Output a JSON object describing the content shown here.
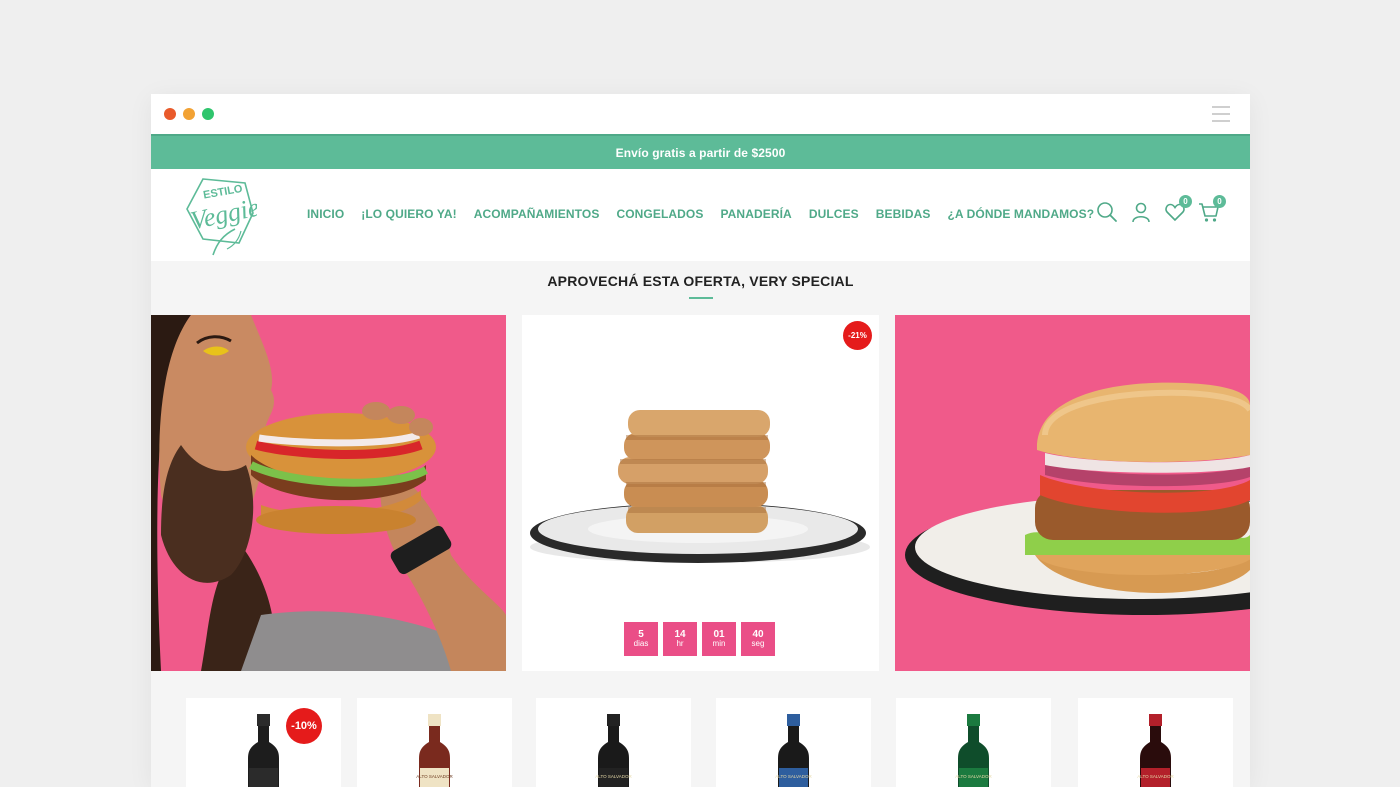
{
  "colors": {
    "brand_green": "#5dbb98",
    "nav_green": "#4fa988",
    "pink": "#f05a8a",
    "countdown_pink": "#ea4e87",
    "badge_red": "#e51b1b",
    "dot_red": "#e95a2b",
    "dot_orange": "#f2a234",
    "dot_green": "#2fc56d"
  },
  "window": {
    "menu_icon": "hamburger-icon"
  },
  "promo": {
    "text": "Envío gratis a partir de $2500"
  },
  "header": {
    "logo_top": "ESTILO",
    "logo_main": "Veggie",
    "nav": [
      "INICIO",
      "¡LO QUIERO YA!",
      "ACOMPAÑAMIENTOS",
      "CONGELADOS",
      "PANADERÍA",
      "DULCES",
      "BEBIDAS",
      "¿A DÓNDE MANDAMOS?"
    ],
    "icons": [
      "search-icon",
      "user-icon",
      "heart-icon",
      "cart-icon"
    ],
    "wishlist_count": "0",
    "cart_count": "0"
  },
  "offer": {
    "title": "APROVECHÁ ESTA OFERTA, VERY SPECIAL",
    "discount": "-21%",
    "countdown": [
      {
        "value": "5",
        "unit": "dias"
      },
      {
        "value": "14",
        "unit": "hr"
      },
      {
        "value": "01",
        "unit": "min"
      },
      {
        "value": "40",
        "unit": "seg"
      }
    ]
  },
  "products": [
    {
      "discount": "-10%",
      "label_color": "#1d1d1d",
      "label_band": "#2b2b2b",
      "label_text": ""
    },
    {
      "discount": "",
      "label_color": "#7a2a1e",
      "label_band": "#efe3c4",
      "label_text": "ALTO SALVADOR"
    },
    {
      "discount": "",
      "label_color": "#1a1a1a",
      "label_band": "#222",
      "label_text": "ALTO SALVADOR"
    },
    {
      "discount": "",
      "label_color": "#1a1a1a",
      "label_band": "#2e5e9e",
      "label_text": "ALTO SALVADOR"
    },
    {
      "discount": "",
      "label_color": "#0f4d2b",
      "label_band": "#1b7a3f",
      "label_text": "ALTO SALVADOR"
    },
    {
      "discount": "",
      "label_color": "#2a0c0c",
      "label_band": "#b3202a",
      "label_text": "ALTO SALVADOR"
    }
  ]
}
